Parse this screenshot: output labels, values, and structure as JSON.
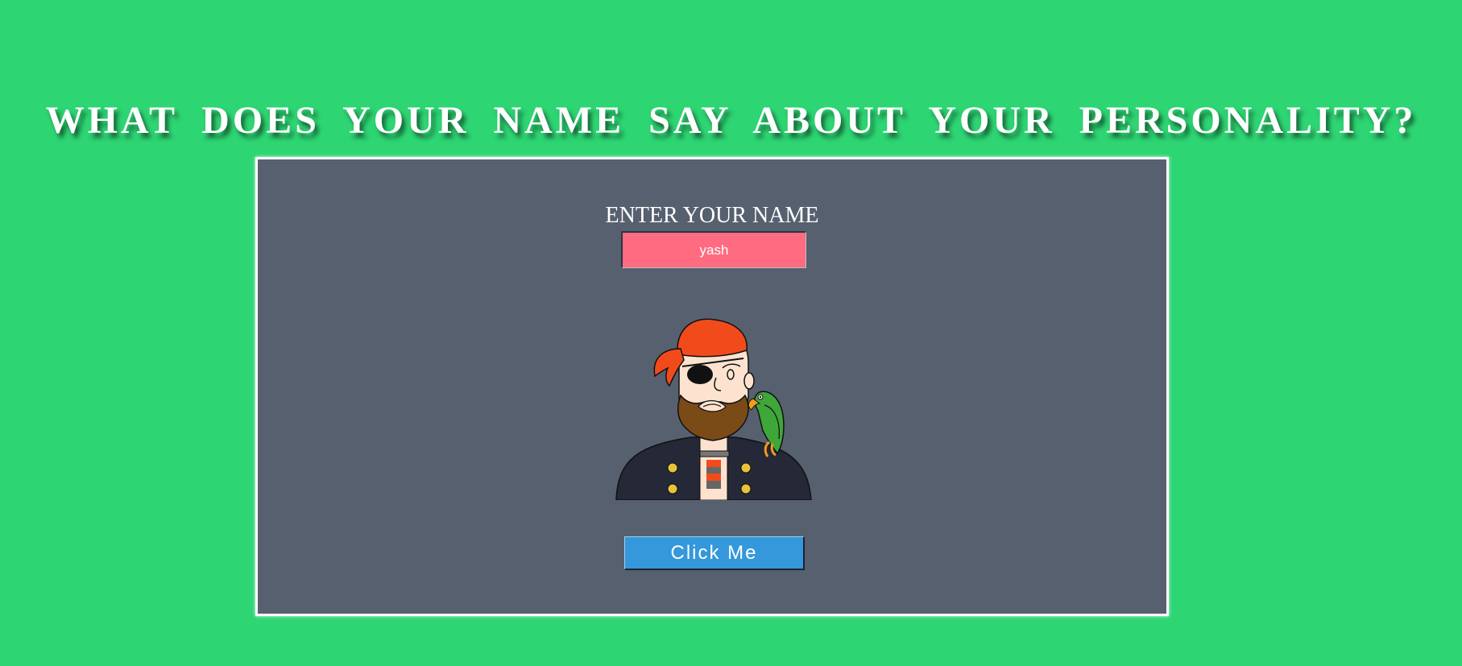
{
  "page": {
    "title": "WHAT DOES YOUR NAME SAY ABOUT YOUR PERSONALITY?",
    "background_color": "#2ed573"
  },
  "card": {
    "background_color": "#57606f",
    "border_color": "#ffffff"
  },
  "form": {
    "label": "ENTER YOUR NAME",
    "name_value": "yash",
    "input_color": "#ff6b81",
    "button_label": "Click Me",
    "button_color": "#3498db"
  },
  "illustration": {
    "icon": "pirate-with-parrot-icon"
  }
}
